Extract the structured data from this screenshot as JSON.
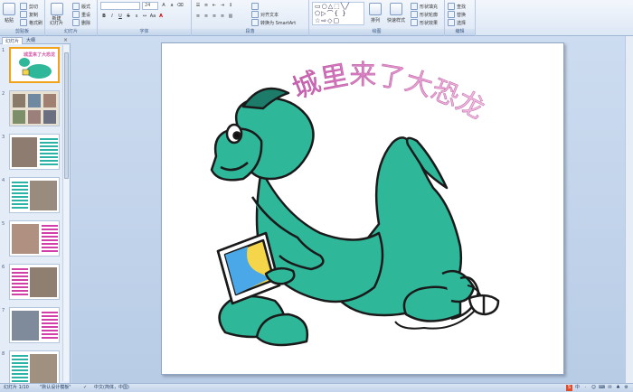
{
  "ribbon": {
    "clipboard": {
      "paste": "粘贴",
      "cut": "剪切",
      "copy": "复制",
      "format_painter": "格式刷",
      "label": "剪贴板"
    },
    "slides": {
      "new_slide": "新建\n幻灯片",
      "layout": "版式",
      "reset": "重设",
      "delete": "删除",
      "label": "幻灯片"
    },
    "font": {
      "size": "24",
      "label": "字体"
    },
    "paragraph": {
      "align_text": "对齐文本",
      "smartart": "转换为 SmartArt",
      "label": "段落"
    },
    "drawing": {
      "arrange": "排列",
      "quick_styles": "快速样式",
      "shape_fill": "形状填充",
      "shape_outline": "形状轮廓",
      "shape_effects": "形状效果",
      "label": "绘图"
    },
    "editing": {
      "find": "查找",
      "replace": "替换",
      "select": "选择",
      "label": "编辑"
    }
  },
  "panel": {
    "tab_slides": "幻灯片",
    "tab_outline": "大纲",
    "close": "×",
    "thumbnails": [
      {
        "num": "1",
        "title": "城里来了大恐龙",
        "selected": true
      },
      {
        "num": "2"
      },
      {
        "num": "3"
      },
      {
        "num": "4"
      },
      {
        "num": "5"
      },
      {
        "num": "6"
      },
      {
        "num": "7"
      },
      {
        "num": "8"
      }
    ]
  },
  "slide": {
    "title": "城里来了大恐龙"
  },
  "status": {
    "slide_pos": "幻灯片 1/10",
    "theme": "\"默认设计模板\"",
    "language": "中文(简体，中国)"
  },
  "tray": [
    "S",
    "中",
    "·",
    "☺",
    "⌨",
    "✉",
    "♣",
    "⚙"
  ],
  "colors": {
    "title": "#d35aa9",
    "dino": "#2fb79a",
    "dino_dark": "#1c7c69",
    "accent": "#f0a21b"
  }
}
